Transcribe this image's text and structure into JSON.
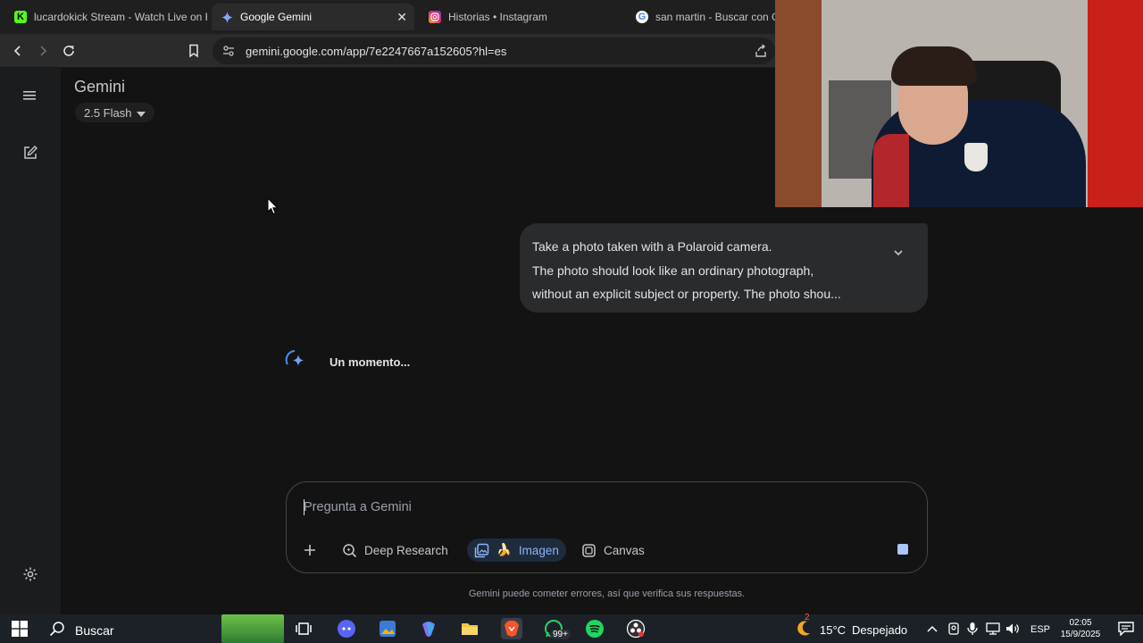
{
  "browser": {
    "tabs": [
      {
        "label": "lucardokick Stream - Watch Live on K",
        "favicon": "kick-icon",
        "color": "#53fc18"
      },
      {
        "label": "Google Gemini",
        "favicon": "gemini-icon",
        "active": true
      },
      {
        "label": "Historias • Instagram",
        "favicon": "instagram-icon"
      },
      {
        "label": "san martin - Buscar con Go",
        "favicon": "google-icon"
      }
    ],
    "url": "gemini.google.com/app/7e2247667a152605?hl=es"
  },
  "app": {
    "title": "Gemini",
    "model": "2.5 Flash"
  },
  "conversation": {
    "user_prompt_lines": [
      "Take a photo taken with a Polaroid camera.",
      "The photo should look like an ordinary photograph,",
      "without an explicit subject or property. The photo shou..."
    ],
    "status": "Un momento..."
  },
  "composer": {
    "placeholder": "Pregunta a Gemini",
    "tools": {
      "deep_research": "Deep Research",
      "image": "Imagen",
      "image_emoji": "🍌",
      "canvas": "Canvas"
    }
  },
  "disclaimer": "Gemini puede cometer errores, así que verifica sus respuestas.",
  "taskbar": {
    "search": "Buscar",
    "weather_temp": "15°C",
    "weather_text": "Despejado",
    "weather_badge": "2",
    "whatsapp_badge": "99+",
    "language": "ESP",
    "time": "02:05",
    "date": "15/9/2025"
  },
  "colors": {
    "background": "#131314",
    "sidebar": "#1b1c1d",
    "accent": "#8ab4f8",
    "bubble": "#2a2b2d"
  }
}
